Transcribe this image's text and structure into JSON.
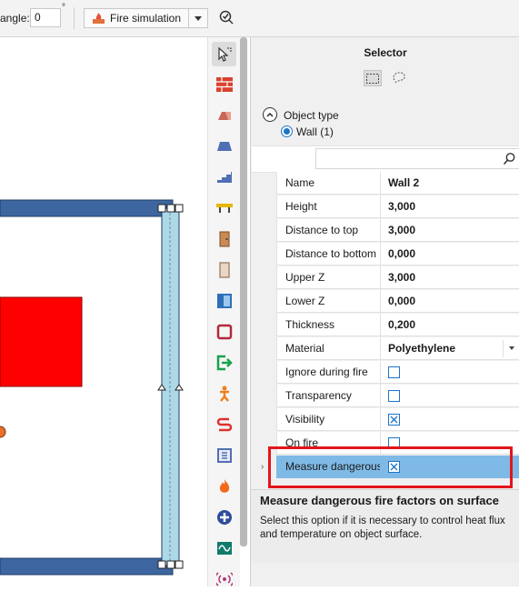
{
  "toolbar": {
    "angle_label": "angle:",
    "angle_value": "0",
    "angle_unit": "°",
    "fire_simulation_label": "Fire simulation",
    "icons": [
      "fire-icon",
      "chevron-down-icon",
      "check-tool-icon"
    ]
  },
  "tools": [
    {
      "name": "select-tool",
      "icon": "cursor-icon",
      "active": true
    },
    {
      "name": "wall-tool",
      "icon": "brick-wall-icon"
    },
    {
      "name": "slab-tool",
      "icon": "slab-icon"
    },
    {
      "name": "roof-tool",
      "icon": "roof-icon"
    },
    {
      "name": "stairs-tool",
      "icon": "stairs-icon"
    },
    {
      "name": "beam-tool",
      "icon": "beam-icon"
    },
    {
      "name": "door-tool",
      "icon": "door-icon"
    },
    {
      "name": "opening-tool",
      "icon": "opening-icon"
    },
    {
      "name": "window-tool",
      "icon": "window-icon"
    },
    {
      "name": "room-tool",
      "icon": "room-icon"
    },
    {
      "name": "exit-tool",
      "icon": "exit-icon"
    },
    {
      "name": "person-tool",
      "icon": "person-icon"
    },
    {
      "name": "route-tool",
      "icon": "route-icon"
    },
    {
      "name": "area-tool",
      "icon": "area-icon"
    },
    {
      "name": "fire-tool",
      "icon": "flame-icon"
    },
    {
      "name": "extinguish-tool",
      "icon": "extinguisher-icon"
    },
    {
      "name": "sensor-tool",
      "icon": "sensor-icon"
    },
    {
      "name": "alarm-tool",
      "icon": "alarm-icon"
    }
  ],
  "selector": {
    "title": "Selector",
    "object_type_label": "Object type",
    "wall_option": "Wall (1)",
    "search_placeholder": ""
  },
  "properties": [
    {
      "name": "Name",
      "value": "Wall 2",
      "type": "text"
    },
    {
      "name": "Height",
      "value": "3,000",
      "type": "text"
    },
    {
      "name": "Distance to top",
      "value": "3,000",
      "type": "text"
    },
    {
      "name": "Distance to bottom",
      "value": "0,000",
      "type": "text"
    },
    {
      "name": "Upper Z",
      "value": "3,000",
      "type": "text"
    },
    {
      "name": "Lower Z",
      "value": "0,000",
      "type": "text"
    },
    {
      "name": "Thickness",
      "value": "0,200",
      "type": "text"
    },
    {
      "name": "Material",
      "value": "Polyethylene",
      "type": "dropdown"
    },
    {
      "name": "Ignore during fire",
      "checked": false,
      "type": "checkbox"
    },
    {
      "name": "Transparency",
      "checked": false,
      "type": "checkbox"
    },
    {
      "name": "Visibility",
      "checked": true,
      "type": "checkbox"
    },
    {
      "name": "On fire",
      "checked": false,
      "type": "checkbox"
    },
    {
      "name": "Measure dangerous",
      "checked": true,
      "type": "checkbox",
      "selected": true
    }
  ],
  "description": {
    "title": "Measure dangerous fire factors on surface",
    "text": "Select this option if it is necessary to control heat flux and temperature on object surface."
  },
  "colors": {
    "wall_fill": "#3d66a0",
    "selected_wall": "#add8e6",
    "fire_source": "#ff0000",
    "selection_row": "#7fbae6",
    "highlight_border": "#e3151b",
    "accent": "#1e73c8"
  }
}
